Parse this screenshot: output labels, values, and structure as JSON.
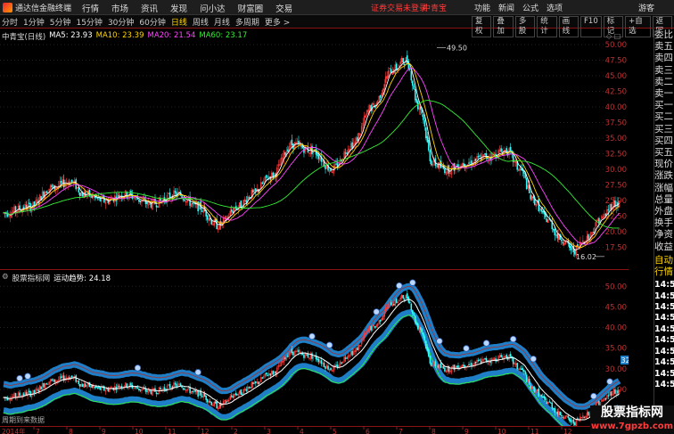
{
  "titlebar": {
    "app_name": "通达信金融终端",
    "menu": [
      "行情",
      "市场",
      "资讯",
      "发现",
      "问小达",
      "财富圈",
      "交易"
    ],
    "warning": "证券交易未登录",
    "stock": "中青宝",
    "right": [
      "功能",
      "新闻",
      "公式",
      "选项"
    ],
    "guest": "游客"
  },
  "toolbar": {
    "periods": [
      "分时",
      "1分钟",
      "5分钟",
      "15分钟",
      "30分钟",
      "60分钟",
      "日线",
      "周线",
      "月线",
      "多周期",
      "更多 >"
    ],
    "active_period": "日线",
    "tools": [
      "复权",
      "叠加",
      "多股",
      "统计",
      "画线",
      "F10",
      "标记",
      "+自选",
      "返回"
    ]
  },
  "main_legend": {
    "title": "中青宝(日线)",
    "items": [
      {
        "label": "MA5: 23.93",
        "color": "#ffffff"
      },
      {
        "label": "MA10: 23.39",
        "color": "#ffd400"
      },
      {
        "label": "MA20: 21.54",
        "color": "#ff44ff"
      },
      {
        "label": "MA60: 23.17",
        "color": "#33ee33"
      }
    ]
  },
  "sub_legend": {
    "title": "股票指标网",
    "indicator": "运动趋势: 24.18"
  },
  "price_axis": [
    "50.00",
    "47.50",
    "45.00",
    "42.50",
    "40.00",
    "37.50",
    "35.00",
    "32.50",
    "30.00",
    "27.50",
    "25.00",
    "22.50",
    "20.00",
    "17.50"
  ],
  "sub_axis": [
    "50.00",
    "45.00",
    "40.00",
    "35.00",
    "30.00",
    "25.00",
    "20.00"
  ],
  "sub_axis_tag": "32.12",
  "annotations": {
    "high": "49.50",
    "low": "16.02"
  },
  "side_labels": [
    "委比",
    "卖五",
    "卖四",
    "卖三",
    "卖二",
    "卖一",
    "买一",
    "买二",
    "买三",
    "买四",
    "买五",
    "现价",
    "涨跌",
    "涨幅",
    "总量",
    "外盘",
    "换手",
    "净资",
    "收益"
  ],
  "side_labels2": [
    "自动",
    "行情"
  ],
  "side_times": [
    "14:50",
    "14:50",
    "14:50",
    "14:50",
    "14:50",
    "14:50",
    "14:50",
    "14:50",
    "14:50",
    "14:50"
  ],
  "date_axis": {
    "start": "2014年",
    "ticks": [
      "7",
      "8",
      "9",
      "10",
      "11",
      "12",
      "2",
      "3",
      "4",
      "5",
      "6",
      "7",
      "8",
      "9",
      "10",
      "11",
      "12",
      "2"
    ]
  },
  "note": "周期到来数据",
  "watermark": {
    "line1": "股票指标网",
    "line2": "www.7gpzb.com"
  },
  "colors": {
    "up": "#ff3b3b",
    "down": "#33ffff",
    "ma5": "#ffffff",
    "ma10": "#ffd400",
    "ma20": "#ff44ff",
    "ma60": "#33ee33",
    "band": "#1e7fc8"
  }
}
